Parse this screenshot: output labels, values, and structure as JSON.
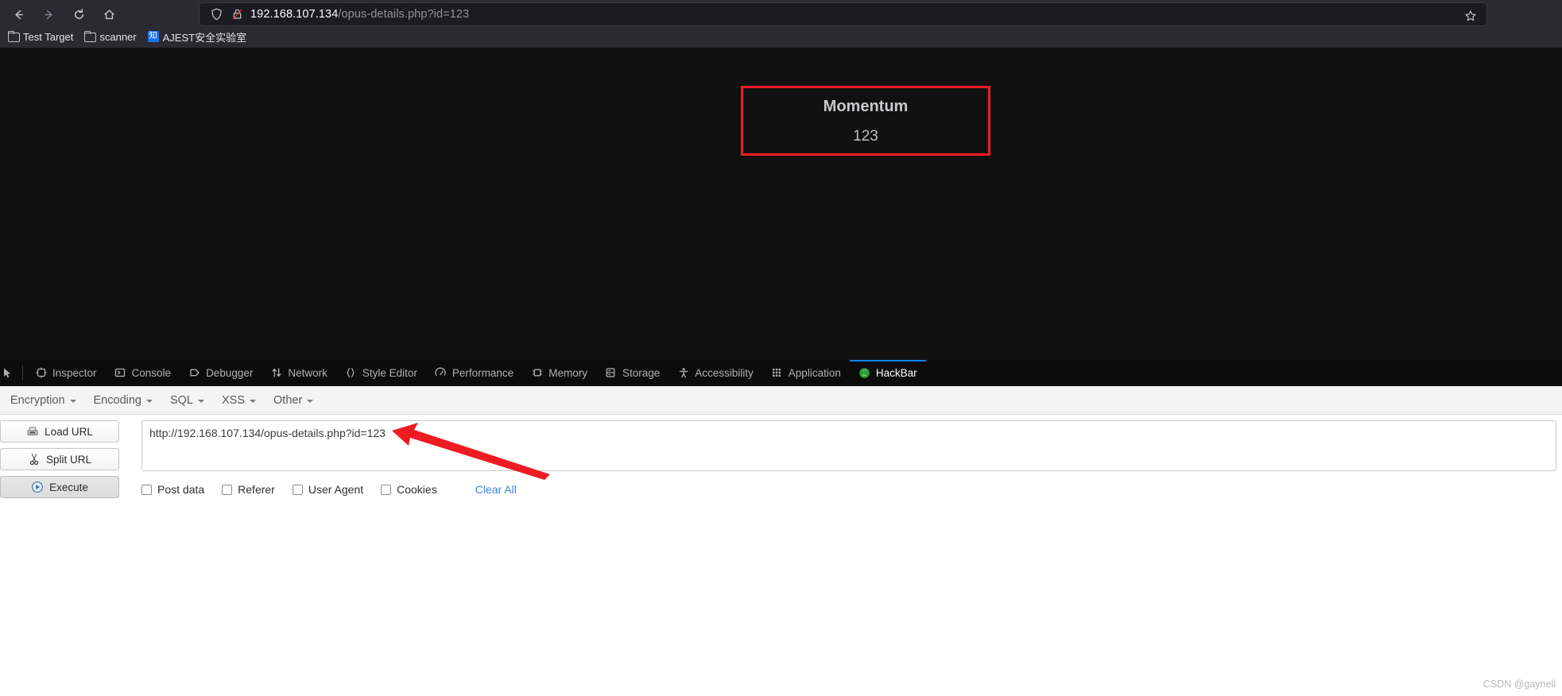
{
  "browser": {
    "nav": {
      "back_label": "Back",
      "forward_label": "Forward",
      "reload_label": "Reload",
      "home_label": "Home"
    },
    "urlbar": {
      "host": "192.168.107.134",
      "path": "/opus-details.php?id=123",
      "full_url": "192.168.107.134/opus-details.php?id=123",
      "shield_icon": "shield-icon",
      "lock_icon": "lock-slash-icon",
      "bookmark_icon": "star-icon"
    },
    "bookmarks": [
      {
        "label": "Test Target",
        "icon": "folder-icon"
      },
      {
        "label": "scanner",
        "icon": "folder-icon"
      },
      {
        "label": "AJEST安全实验室",
        "icon": "favicon-zhi",
        "favicon_text": "知"
      }
    ]
  },
  "page": {
    "background": "#111111",
    "card": {
      "title": "Momentum",
      "value": "123",
      "border_color": "#ee1c22"
    }
  },
  "devtools": {
    "picker_icon": "element-picker-icon",
    "tabs": [
      {
        "label": "Inspector",
        "icon": "inspector-icon",
        "active": false
      },
      {
        "label": "Console",
        "icon": "console-icon",
        "active": false
      },
      {
        "label": "Debugger",
        "icon": "debugger-icon",
        "active": false
      },
      {
        "label": "Network",
        "icon": "network-icon",
        "active": false
      },
      {
        "label": "Style Editor",
        "icon": "style-editor-icon",
        "active": false
      },
      {
        "label": "Performance",
        "icon": "performance-icon",
        "active": false
      },
      {
        "label": "Memory",
        "icon": "memory-icon",
        "active": false
      },
      {
        "label": "Storage",
        "icon": "storage-icon",
        "active": false
      },
      {
        "label": "Accessibility",
        "icon": "accessibility-icon",
        "active": false
      },
      {
        "label": "Application",
        "icon": "application-icon",
        "active": false
      },
      {
        "label": "HackBar",
        "icon": "hackbar-icon",
        "active": true
      }
    ],
    "active_tab": "HackBar",
    "active_indicator_color": "#0a84ff"
  },
  "hackbar": {
    "menus": [
      {
        "label": "Encryption"
      },
      {
        "label": "Encoding"
      },
      {
        "label": "SQL"
      },
      {
        "label": "XSS"
      },
      {
        "label": "Other"
      }
    ],
    "buttons": [
      {
        "label": "Load URL",
        "icon": "load-url-icon",
        "pressed": false
      },
      {
        "label": "Split URL",
        "icon": "scissors-icon",
        "pressed": false
      },
      {
        "label": "Execute",
        "icon": "play-icon",
        "pressed": true
      }
    ],
    "url_field": {
      "value": "http://192.168.107.134/opus-details.php?id=123",
      "placeholder": ""
    },
    "checkboxes": [
      {
        "label": "Post data",
        "checked": false
      },
      {
        "label": "Referer",
        "checked": false
      },
      {
        "label": "User Agent",
        "checked": false
      },
      {
        "label": "Cookies",
        "checked": false
      }
    ],
    "clear_all_label": "Clear All",
    "clear_all_color": "#3b87d8"
  },
  "annotation": {
    "arrow_color": "#ee1c22",
    "arrow_label": "points-to-url-field"
  },
  "watermark": {
    "text": "CSDN @gaynell"
  }
}
